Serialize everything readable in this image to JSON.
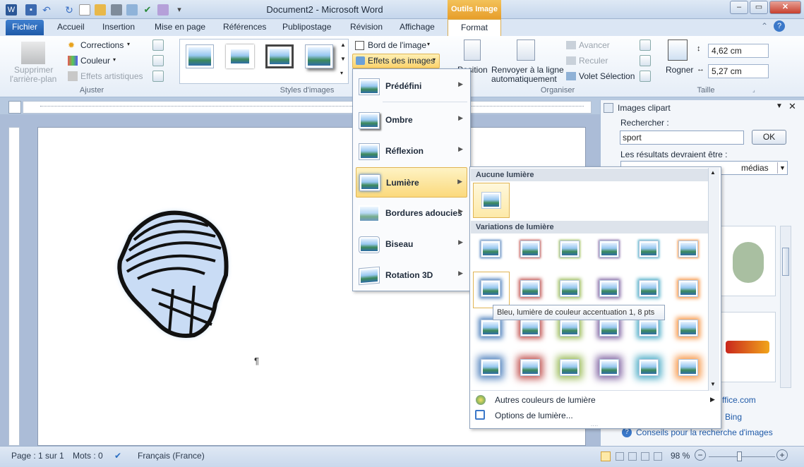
{
  "window": {
    "title": "Document2 - Microsoft Word",
    "contextual_group": "Outils Image"
  },
  "tabs": [
    "Fichier",
    "Accueil",
    "Insertion",
    "Mise en page",
    "Références",
    "Publipostage",
    "Révision",
    "Affichage",
    "Format"
  ],
  "ribbon": {
    "ajuster": {
      "label": "Ajuster",
      "remove_bg": "Supprimer l'arrière-plan",
      "remove_bg_l1": "Supprimer",
      "remove_bg_l2": "l'arrière-plan",
      "corrections": "Corrections",
      "couleur": "Couleur",
      "effets_artistiques": "Effets artistiques"
    },
    "styles": {
      "label": "Styles d'images",
      "bord": "Bord de l'image",
      "effets": "Effets des images"
    },
    "organiser": {
      "label": "Organiser",
      "position": "Position",
      "renvoyer_l1": "Renvoyer à la ligne",
      "renvoyer_l2": "automatiquement",
      "avancer": "Avancer",
      "reculer": "Reculer",
      "volet": "Volet Sélection"
    },
    "taille": {
      "label": "Taille",
      "rogner": "Rogner",
      "height": "4,62 cm",
      "width": "5,27 cm"
    }
  },
  "effects_menu": {
    "items": [
      {
        "label": "Prédéfini"
      },
      {
        "label": "Ombre"
      },
      {
        "label": "Réflexion"
      },
      {
        "label": "Lumière"
      },
      {
        "label": "Bordures adoucies"
      },
      {
        "label": "Biseau"
      },
      {
        "label": "Rotation 3D"
      }
    ]
  },
  "glow_panel": {
    "no_glow": "Aucune lumière",
    "variations": "Variations de lumière",
    "tooltip": "Bleu, lumière de couleur accentuation 1, 8 pts",
    "more_colors": "Autres couleurs de lumière",
    "options": "Options de lumière...",
    "colors": [
      "#4f81bd",
      "#c0504d",
      "#9bbb59",
      "#8064a2",
      "#4bacc6",
      "#f79646"
    ]
  },
  "clipart": {
    "title": "Images clipart",
    "search_label": "Rechercher :",
    "search_value": "sport",
    "ok": "OK",
    "results_label": "Les résultats devraient être :",
    "results_value": "médias",
    "link1": "ffice.com",
    "link2": "Bing",
    "tips": "Conseils pour la recherche d'images"
  },
  "document": {
    "pilcrow": "¶"
  },
  "status": {
    "page": "Page : 1 sur 1",
    "words": "Mots : 0",
    "language": "Français (France)",
    "zoom": "98 %"
  }
}
